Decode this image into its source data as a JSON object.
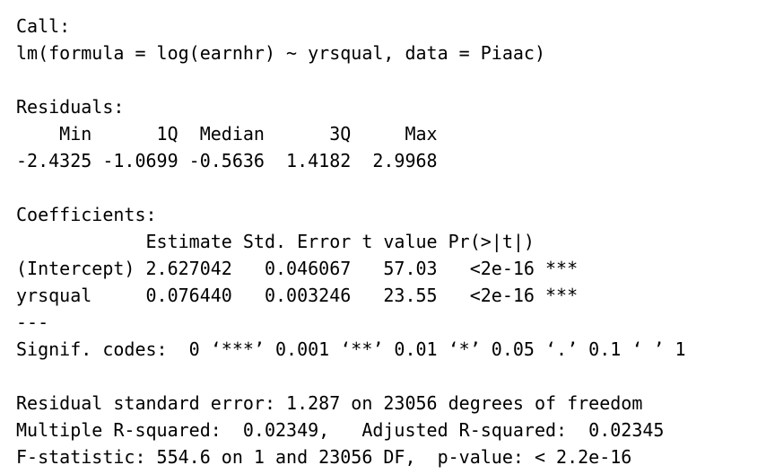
{
  "console": {
    "lines": [
      "Call:",
      "lm(formula = log(earnhr) ~ yrsqual, data = Piaac)",
      "",
      "Residuals:",
      "    Min      1Q  Median      3Q     Max ",
      "-2.4325 -1.0699 -0.5636  1.4182  2.9968 ",
      "",
      "Coefficients:",
      "            Estimate Std. Error t value Pr(>|t|)    ",
      "(Intercept) 2.627042   0.046067   57.03   <2e-16 ***",
      "yrsqual     0.076440   0.003246   23.55   <2e-16 ***",
      "---",
      "Signif. codes:  0 ‘***’ 0.001 ‘**’ 0.01 ‘*’ 0.05 ‘.’ 0.1 ‘ ’ 1",
      "",
      "Residual standard error: 1.287 on 23056 degrees of freedom",
      "Multiple R-squared:  0.02349,\tAdjusted R-squared:  0.02345 ",
      "F-statistic: 554.6 on 1 and 23056 DF,  p-value: < 2.2e-16"
    ]
  }
}
